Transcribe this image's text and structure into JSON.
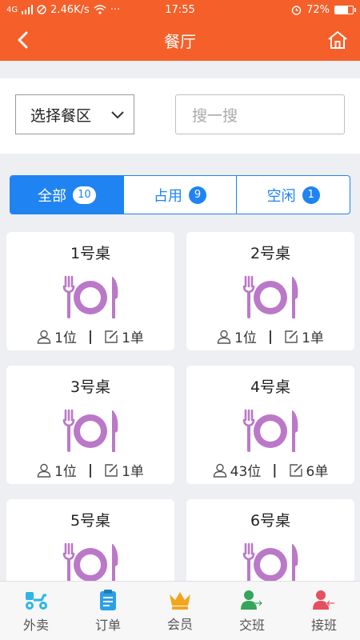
{
  "status_bar": {
    "network": "4G",
    "speed": "2.46K/s",
    "more": "···",
    "time": "17:55",
    "battery": "72%",
    "battery_level": 0.72
  },
  "header": {
    "title": "餐厅"
  },
  "filters": {
    "area_select": "选择餐区",
    "search_placeholder": "搜一搜"
  },
  "tabs": [
    {
      "label": "全部",
      "count": "10",
      "active": true
    },
    {
      "label": "占用",
      "count": "9",
      "active": false
    },
    {
      "label": "空闲",
      "count": "1",
      "active": false
    }
  ],
  "tables": [
    {
      "name": "1号桌",
      "guests": "1位",
      "orders": "1单"
    },
    {
      "name": "2号桌",
      "guests": "1位",
      "orders": "1单"
    },
    {
      "name": "3号桌",
      "guests": "1位",
      "orders": "1单"
    },
    {
      "name": "4号桌",
      "guests": "43位",
      "orders": "6单"
    },
    {
      "name": "5号桌",
      "guests": "",
      "orders": ""
    },
    {
      "name": "6号桌",
      "guests": "",
      "orders": ""
    }
  ],
  "bottom_nav": [
    {
      "label": "外卖",
      "icon": "delivery-scooter-icon",
      "color": "#2bb6e6"
    },
    {
      "label": "订单",
      "icon": "order-clipboard-icon",
      "color": "#2ba0e6"
    },
    {
      "label": "会员",
      "icon": "crown-icon",
      "color": "#f2a51d"
    },
    {
      "label": "交班",
      "icon": "handover-user-icon",
      "color": "#35a55a"
    },
    {
      "label": "接班",
      "icon": "takeover-user-icon",
      "color": "#e5505f"
    }
  ],
  "colors": {
    "header": "#f5602a",
    "accent": "#1f84f2",
    "dish_icon": "#bb78c8"
  }
}
